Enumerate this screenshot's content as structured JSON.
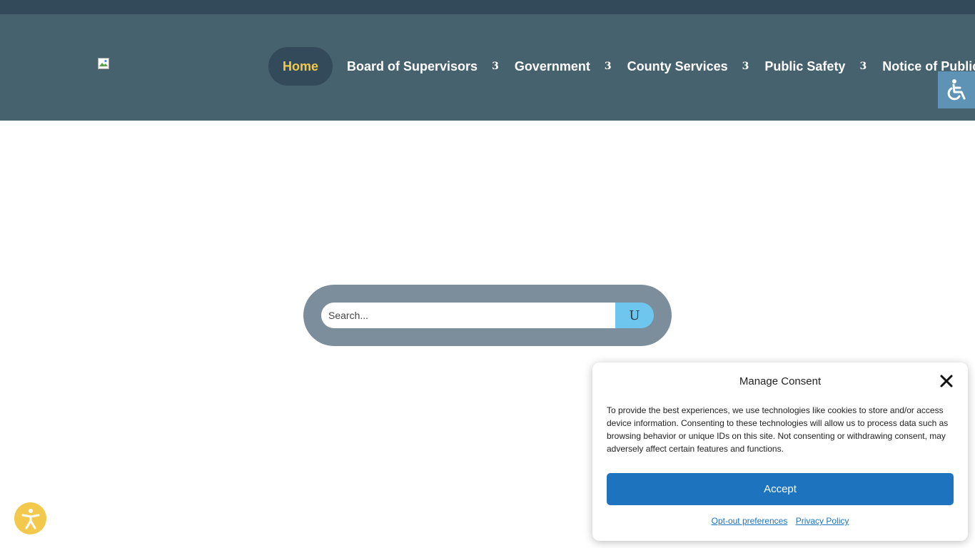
{
  "header": {
    "logo_alt": "",
    "nav": {
      "home": "Home",
      "items": [
        {
          "label": "Board of Supervisors",
          "chevron": "3"
        },
        {
          "label": "Government",
          "chevron": "3"
        },
        {
          "label": "County Services",
          "chevron": "3"
        },
        {
          "label": "Public Safety",
          "chevron": "3"
        },
        {
          "label": "Notice of Public"
        }
      ]
    }
  },
  "accessibility_tab": {
    "icon": "wheelchair-icon"
  },
  "search": {
    "placeholder": "Search...",
    "button_glyph": "U"
  },
  "accessibility_float": {
    "icon": "accessibility-person-icon"
  },
  "consent": {
    "title": "Manage Consent",
    "body": "To provide the best experiences, we use technologies like cookies to store and/or access device information. Consenting to these technologies will allow us to process data such as browsing behavior or unique IDs on this site. Not consenting or withdrawing consent, may adversely affect certain features and functions.",
    "accept": "Accept",
    "links": [
      "Opt-out preferences",
      "Privacy Policy"
    ]
  },
  "colors": {
    "top_strip": "#334a5a",
    "header_bg": "#47626f",
    "home_active_text": "#f2c94c",
    "accept_button": "#1e73be",
    "search_button": "#6ec6ef"
  }
}
